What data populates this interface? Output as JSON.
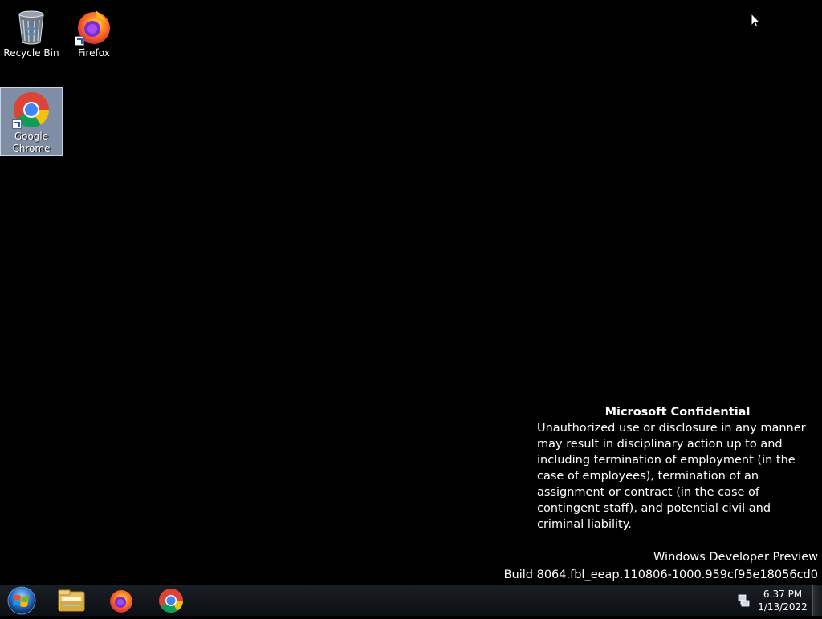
{
  "desktop": {
    "icons": [
      {
        "label": "Recycle Bin",
        "icon": "recycle-bin-icon"
      },
      {
        "label": "Firefox",
        "icon": "firefox-icon"
      },
      {
        "label": "Google Chrome",
        "icon": "chrome-icon",
        "selected": true
      }
    ],
    "notice": {
      "heading": "Microsoft Confidential",
      "body": "Unauthorized use or disclosure in any manner may result in disciplinary action up to and including termination of employment (in the case of employees), termination of an assignment or contract (in the case of contingent staff), and potential civil and criminal liability."
    },
    "watermark": {
      "line1": "Windows Developer Preview",
      "line2": "Build 8064.fbl_eeap.110806-1000.959cf95e18056cd0"
    }
  },
  "taskbar": {
    "start": {
      "icon": "windows-start-icon"
    },
    "pinned": [
      {
        "name": "Windows Explorer",
        "icon": "folder-icon"
      },
      {
        "name": "Firefox",
        "icon": "firefox-icon"
      },
      {
        "name": "Google Chrome",
        "icon": "chrome-icon"
      }
    ],
    "tray": {
      "network_icon": "network-icon",
      "time": "6:37 PM",
      "date": "1/13/2022"
    }
  },
  "colors": {
    "desktop_background": "#000000",
    "selection": "#aabedc",
    "text": "#ffffff"
  }
}
